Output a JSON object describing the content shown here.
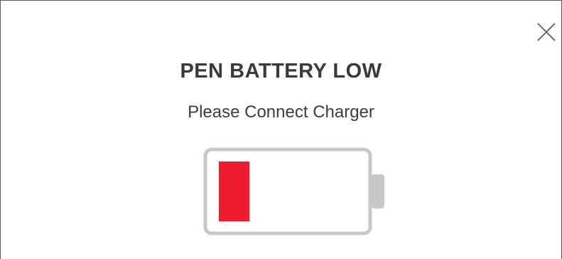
{
  "dialog": {
    "title": "PEN BATTERY LOW",
    "message": "Please Connect Charger"
  },
  "close_icon": "close-icon",
  "battery": {
    "icon": "battery-low-icon",
    "level_percent": 22,
    "fill_color": "#ed1c2e",
    "outline_color": "#c8c8c8"
  }
}
